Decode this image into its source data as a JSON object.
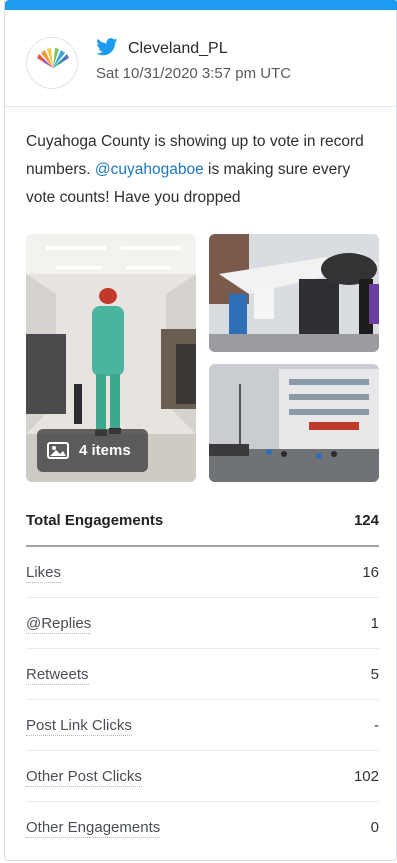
{
  "header": {
    "handle": "Cleveland_PL",
    "timestamp": "Sat 10/31/2020 3:57 pm UTC"
  },
  "post": {
    "text_before": "Cuyahoga County is showing up to vote in record numbers. ",
    "mention": "@cuyahogaboe",
    "text_after": " is making sure every vote counts! Have you dropped"
  },
  "media": {
    "items_label": "4 items"
  },
  "stats": {
    "total": {
      "label": "Total Engagements",
      "value": "124"
    },
    "rows": [
      {
        "label": "Likes",
        "value": "16"
      },
      {
        "label": "@Replies",
        "value": "1"
      },
      {
        "label": "Retweets",
        "value": "5"
      },
      {
        "label": "Post Link Clicks",
        "value": "-"
      },
      {
        "label": "Other Post Clicks",
        "value": "102"
      },
      {
        "label": "Other Engagements",
        "value": "0"
      }
    ]
  },
  "colors": {
    "accent": "#1d9bf0",
    "mention": "#1d78c1"
  },
  "icons": [
    "twitter-bird-icon",
    "image-icon"
  ]
}
